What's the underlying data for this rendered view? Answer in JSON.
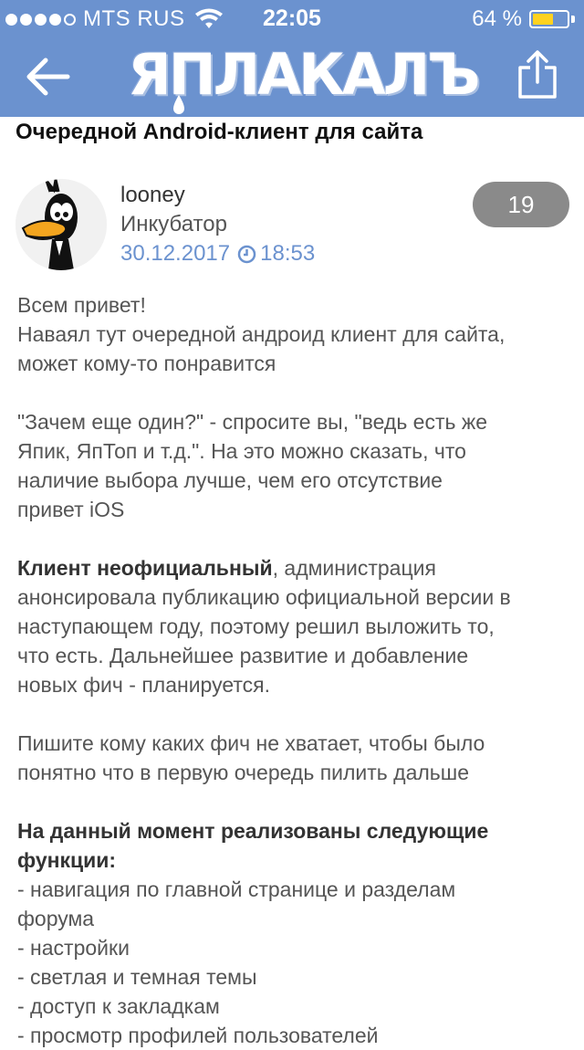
{
  "status_bar": {
    "carrier": "MTS RUS",
    "time": "22:05",
    "battery_percent": "64 %",
    "battery_level": 0.64,
    "signal_bars_filled": 4,
    "signal_bars_total": 5
  },
  "nav": {
    "back_icon": "arrow-left-icon",
    "share_icon": "share-icon",
    "logo_text": "ЯПЛАКАЛЪ"
  },
  "post": {
    "title": "Очередной Android-клиент для сайта",
    "author": {
      "name": "looney",
      "rank": "Инкубатор"
    },
    "date": "30.12.2017",
    "time": "18:53",
    "count": "19",
    "paragraphs": {
      "p1": [
        "Всем привет!",
        "Наваял тут очередной андроид клиент для сайта,",
        "может кому-то понравится"
      ],
      "p2": [
        "\"Зачем еще один?\" - спросите вы, \"ведь есть же",
        "Япик, ЯпТоп и т.д.\". На это можно сказать, что",
        "наличие выбора лучше, чем его отсутствие",
        "привет iOS"
      ],
      "p3_bold": "Клиент неофициальный",
      "p3": [
        ", администрация",
        "анонсировала публикацию официальной версии в",
        "наступающем году, поэтому решил выложить то,",
        "что есть. Дальнейшее развитие и добавление",
        "новых фич - планируется."
      ],
      "p4": [
        "Пишите кому каких фич не хватает, чтобы было",
        "понятно что в первую очередь пилить дальше"
      ],
      "p5_bold": [
        "На данный момент реализованы следующие",
        "функции:"
      ],
      "features": [
        "- навигация по главной странице и разделам",
        "форума",
        "- настройки",
        "- светлая и темная темы",
        "- доступ к закладкам",
        "- просмотр профилей пользователей"
      ]
    }
  },
  "colors": {
    "header_bg": "#6b92cf",
    "link_blue": "#6b92cf",
    "badge_gray": "#8a8a8a",
    "battery_yellow": "#ffd21f"
  }
}
